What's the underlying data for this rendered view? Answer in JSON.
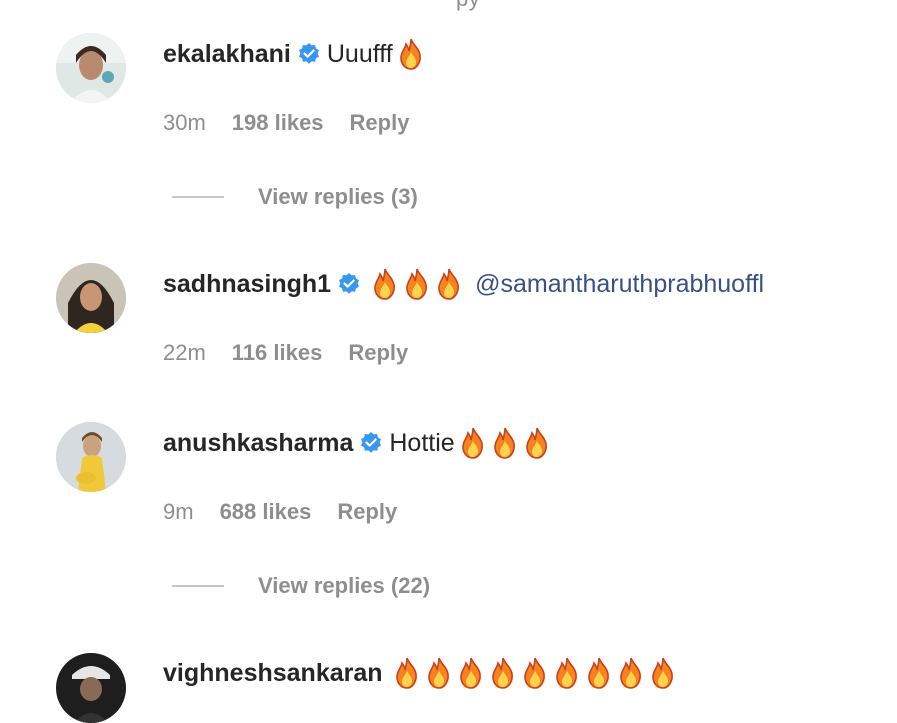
{
  "top_partial_text": "py",
  "colors": {
    "text": "#262626",
    "muted": "#8e8e8e",
    "mention": "#385185",
    "verified": "#3897f0"
  },
  "comments": [
    {
      "username": "ekalakhani",
      "verified": true,
      "text": "Uuufff",
      "mention": "",
      "fire_count": 1,
      "time": "30m",
      "likes": "198 likes",
      "reply": "Reply",
      "view_replies": "View replies (3)"
    },
    {
      "username": "sadhnasingh1",
      "verified": true,
      "text": "",
      "mention": "@samantharuthprabhuoffl",
      "fire_count": 3,
      "time": "22m",
      "likes": "116 likes",
      "reply": "Reply",
      "view_replies": ""
    },
    {
      "username": "anushkasharma",
      "verified": true,
      "text": "Hottie",
      "mention": "",
      "fire_count": 3,
      "time": "9m",
      "likes": "688 likes",
      "reply": "Reply",
      "view_replies": "View replies (22)"
    },
    {
      "username": "vighneshsankaran",
      "verified": false,
      "text": "",
      "mention": "",
      "fire_count": 9,
      "time": "",
      "likes": "",
      "reply": "",
      "view_replies": ""
    }
  ],
  "icons": {
    "verified": "verified-badge-icon",
    "fire": "fire-emoji-icon"
  }
}
